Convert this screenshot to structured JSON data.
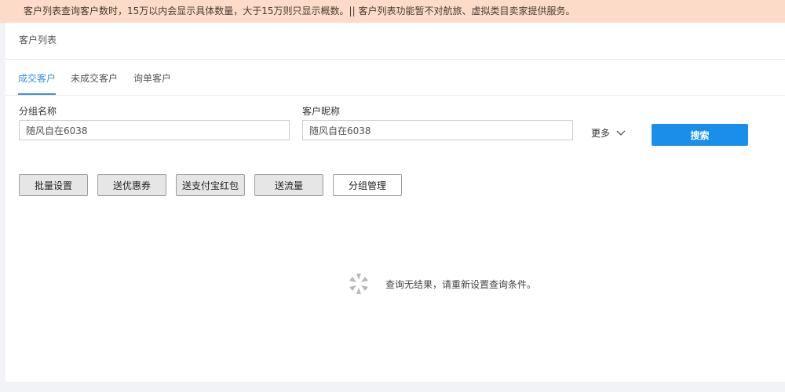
{
  "notice": {
    "text": "客户列表查询客户数时，15万以内会显示具体数量，大于15万则只显示概数。|| 客户列表功能暂不对航旅、虚拟类目卖家提供服务。"
  },
  "panel": {
    "title": "客户列表"
  },
  "tabs": [
    {
      "label": "成交客户",
      "active": true
    },
    {
      "label": "未成交客户",
      "active": false
    },
    {
      "label": "询单客户",
      "active": false
    }
  ],
  "filters": {
    "group_name": {
      "label": "分组名称",
      "value": "随风自在6038"
    },
    "nickname": {
      "label": "客户昵称",
      "value": "随风自在6038"
    },
    "more_label": "更多",
    "search_label": "搜索"
  },
  "actions": [
    {
      "label": "批量设置"
    },
    {
      "label": "送优惠券"
    },
    {
      "label": "送支付宝红包"
    },
    {
      "label": "送流量"
    },
    {
      "label": "分组管理"
    }
  ],
  "empty_state": {
    "icon": "loading-spinner-icon",
    "message": "查询无结果，请重新设置查询条件。"
  },
  "colors": {
    "notice_bg": "#fcdcc8",
    "accent": "#3a8ee6",
    "search_button": "#1a8eeb"
  }
}
